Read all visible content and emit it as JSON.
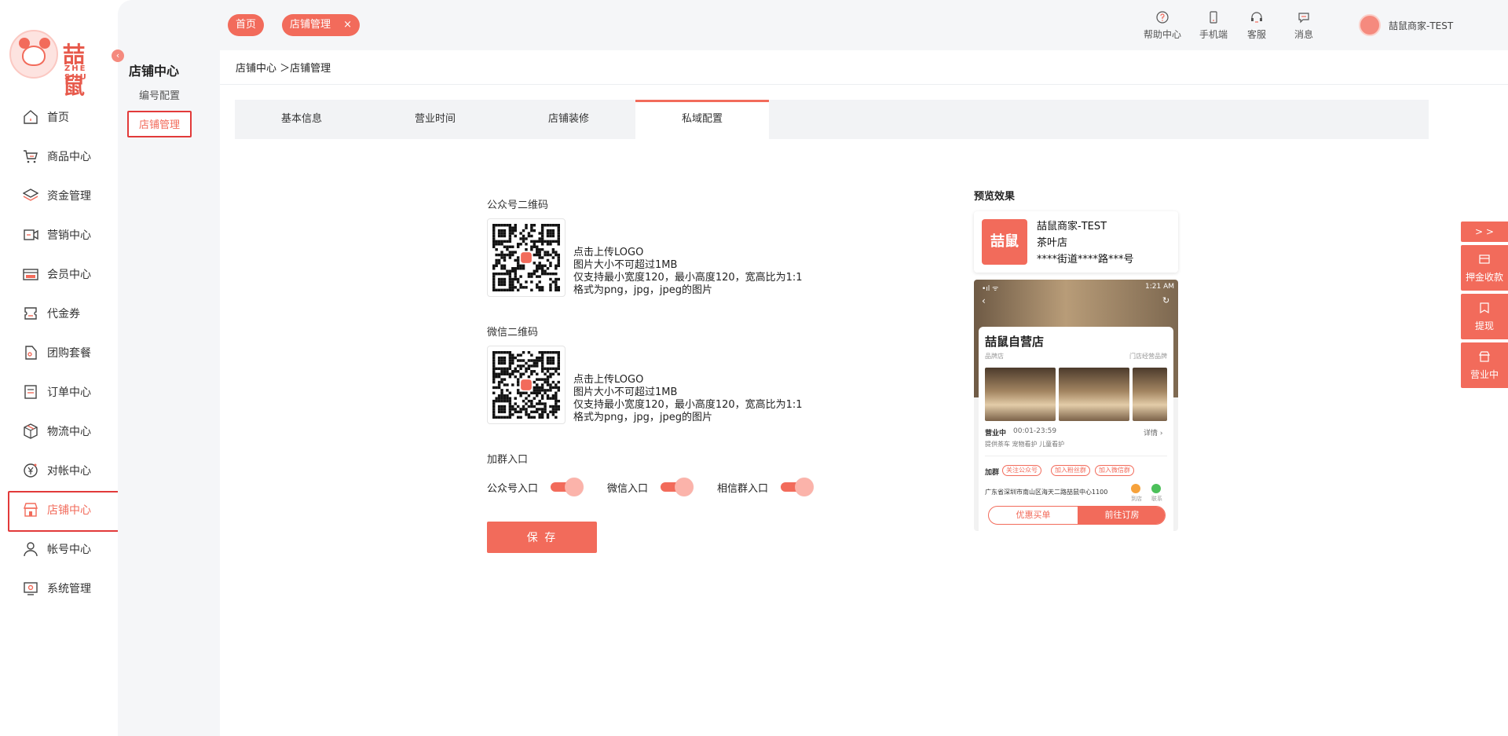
{
  "brand": {
    "name": "喆鼠",
    "sub": "ZHE SHU"
  },
  "sidebar": {
    "items": [
      {
        "label": "首页",
        "icon": "home-icon"
      },
      {
        "label": "商品中心",
        "icon": "cart-icon"
      },
      {
        "label": "资金管理",
        "icon": "layers-icon"
      },
      {
        "label": "营销中心",
        "icon": "video-icon"
      },
      {
        "label": "会员中心",
        "icon": "vip-card-icon"
      },
      {
        "label": "代金券",
        "icon": "coupon-icon"
      },
      {
        "label": "团购套餐",
        "icon": "tag-icon"
      },
      {
        "label": "订单中心",
        "icon": "order-icon"
      },
      {
        "label": "物流中心",
        "icon": "box-icon"
      },
      {
        "label": "对帐中心",
        "icon": "yen-icon"
      },
      {
        "label": "店铺中心",
        "icon": "shop-icon"
      },
      {
        "label": "帐号中心",
        "icon": "user-icon"
      },
      {
        "label": "系统管理",
        "icon": "settings-icon"
      }
    ],
    "active_index": 10
  },
  "subsidebar": {
    "title": "店铺中心",
    "items": [
      {
        "label": "编号配置"
      },
      {
        "label": "店铺管理"
      }
    ]
  },
  "topbar": {
    "tabs": [
      {
        "label": "首页"
      },
      {
        "label": "店铺管理",
        "close": "×"
      }
    ],
    "tools": [
      {
        "label": "帮助中心",
        "icon": "help-icon"
      },
      {
        "label": "手机端",
        "icon": "mobile-icon"
      },
      {
        "label": "客服",
        "icon": "headset-icon"
      },
      {
        "label": "消息",
        "icon": "message-icon"
      }
    ],
    "user": {
      "name": "喆鼠商家-TEST"
    }
  },
  "breadcrumb": {
    "path": "店铺中心 ＞店铺管理"
  },
  "tabs": [
    {
      "label": "基本信息"
    },
    {
      "label": "营业时间"
    },
    {
      "label": "店铺装修"
    },
    {
      "label": "私域配置"
    }
  ],
  "form": {
    "official_qr": {
      "title": "公众号二维码",
      "hints": [
        "点击上传LOGO",
        "图片大小不可超过1MB",
        "仅支持最小宽度120，最小高度120，宽高比为1:1",
        "格式为png，jpg，jpeg的图片"
      ]
    },
    "wechat_qr": {
      "title": "微信二维码",
      "hints": [
        "点击上传LOGO",
        "图片大小不可超过1MB",
        "仅支持最小宽度120，最小高度120，宽高比为1:1",
        "格式为png，jpg，jpeg的图片"
      ]
    },
    "group_entry": {
      "title": "加群入口",
      "switches": [
        {
          "label": "公众号入口",
          "on": true
        },
        {
          "label": "微信入口",
          "on": true
        },
        {
          "label": "相信群入口",
          "on": true
        }
      ]
    },
    "save_label": "保 存"
  },
  "preview": {
    "title": "预览效果",
    "card": {
      "name": "喆鼠商家-TEST",
      "type": "茶叶店",
      "address": "****街道****路***号"
    },
    "phone": {
      "signal": "•ıl ᯤ",
      "time": "1:21 AM",
      "store_name": "喆鼠自营店",
      "tag_left": "品牌店",
      "tag_right": "门店经营品牌",
      "status": "营业中",
      "hours": "00:01-23:59",
      "detail": "详情 ›",
      "facilities": "提供茶车   宠物看护   儿童看护",
      "join": "加群",
      "chips": [
        "关注公众号",
        "加入粉丝群",
        "加入微信群"
      ],
      "address": "广东省深圳市南山区海天二路喆鼠中心1100",
      "actions": [
        "到店",
        "联系"
      ],
      "btn_left": "优惠买单",
      "btn_right": "前往订房"
    }
  },
  "float_panel": {
    "toggle": "> >",
    "items": [
      {
        "label": "押金收款",
        "icon": "receipt-icon"
      },
      {
        "label": "提现",
        "icon": "withdraw-icon"
      },
      {
        "label": "营业中",
        "icon": "store-open-icon"
      }
    ]
  },
  "colors": {
    "accent": "#f26b5b",
    "highlight_border": "#e23a3a",
    "sidebar_bg": "#f5f6f8"
  }
}
